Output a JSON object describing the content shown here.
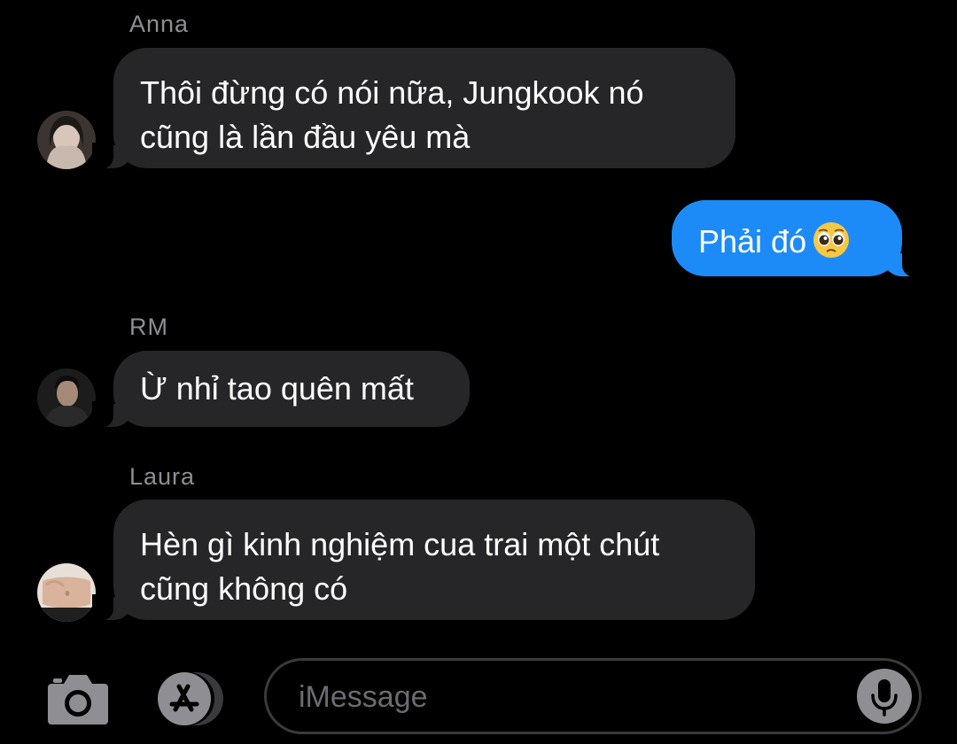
{
  "messages": [
    {
      "sender": "Anna",
      "line1": "Thôi đừng có nói nữa, Jungkook nó",
      "line2": "cũng là lần đầu yêu mà"
    },
    {
      "sender": "",
      "text": "Phải đó",
      "emoji": "pleading-face"
    },
    {
      "sender": "RM",
      "text": "Ừ nhỉ tao quên mất"
    },
    {
      "sender": "Laura",
      "line1": "Hèn gì kinh nghiệm cua trai một chút",
      "line2": "cũng không có"
    }
  ],
  "composer": {
    "placeholder": "iMessage",
    "camera_icon": "camera-icon",
    "apps_icon": "app-store-icon",
    "mic_icon": "microphone-icon"
  },
  "colors": {
    "background": "#000000",
    "incoming_bubble": "#262629",
    "outgoing_bubble": "#1d8bf7",
    "sender_label": "#8e8e93"
  }
}
